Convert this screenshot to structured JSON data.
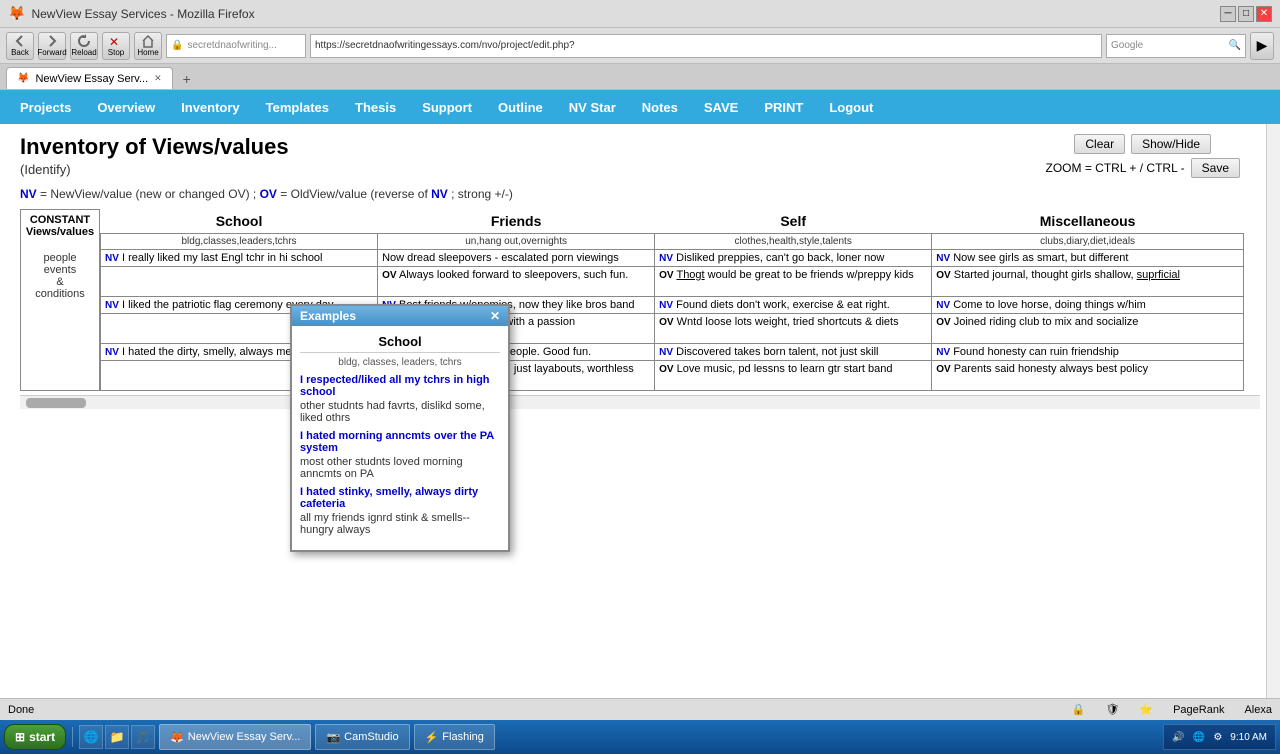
{
  "browser": {
    "title": "NewView Essay Services - Mozilla Firefox",
    "tab_label": "NewView Essay Serv...",
    "address": "https://secretdnaofwritingessays.com/nvo/project/edit.php?",
    "search_placeholder": "Google",
    "nav_buttons": [
      "Back",
      "Forward",
      "Reload",
      "Stop",
      "Home"
    ]
  },
  "nav_menu": {
    "items": [
      "Projects",
      "Overview",
      "Inventory",
      "Templates",
      "Thesis",
      "Support",
      "Outline",
      "NV Star",
      "Notes",
      "SAVE",
      "PRINT",
      "Logout"
    ]
  },
  "toolbar": {
    "clear_label": "Clear",
    "show_hide_label": "Show/Hide",
    "save_label": "Save",
    "zoom_text": "ZOOM = CTRL + / CTRL -"
  },
  "page": {
    "title": "Inventory of Views/values",
    "subtitle": "(Identify)",
    "legend": "NV = NewView/value (new or changed OV) ; OV = OldView/value (reverse of NV; strong +/-)"
  },
  "popup": {
    "title": "Examples",
    "column": "School",
    "subheader": "bldg, classes, leaders, tchrs",
    "items": [
      {
        "nv": "I respected/liked all my tchrs in high school",
        "ov": "other studnts had favrts, dislikd some, liked othrs"
      },
      {
        "nv": "I hated morning anncmts over the PA system",
        "ov": "most other studnts loved morning anncmts on PA"
      },
      {
        "nv": "I hated stinky, smelly, always dirty cafeteria",
        "ov": "all my friends ignrd stink & smells--hungry always"
      }
    ]
  },
  "table": {
    "constant_label": "CONSTANT\nViews/values",
    "constant_sub": "people\nevents\n&\nconditions",
    "columns": [
      {
        "header": "School",
        "subheader": "bldg,classes,leaders,tchrs",
        "rows": [
          {
            "nv": "I really liked my last Engl tchr in hi school",
            "ov": ""
          },
          {
            "nv": "I liked the patriotic flag ceremony every day",
            "ov": ""
          },
          {
            "nv": "I hated the dirty, smelly, always messy bathrooms",
            "ov": ""
          }
        ]
      },
      {
        "header": "Friends",
        "subheader": "un,hang out,overnights",
        "rows": [
          {
            "nv": "Now dread sleepovers - escalated porn viewings",
            "ov": "Always looked forward to sleepovers, such fun."
          },
          {
            "nv": "Best friends w/enemies, now they like bros band",
            "ov": "Hated Jen and Laura with a passion"
          },
          {
            "nv": "Got civic spirit, now help people. Good fun.",
            "ov": "Felt our group of frnds, just layabouts, worthless"
          }
        ]
      },
      {
        "header": "Self",
        "subheader": "clothes,health,style,talents",
        "rows": [
          {
            "nv": "Disliked preppies, can't go back, loner now",
            "ov": "Thogt would be great to be friends w/preppy kids"
          },
          {
            "nv": "Found diets don't work, exercise & eat right.",
            "ov": "Wntd loose lots weight, tried shortcuts & diets"
          },
          {
            "nv": "Discovered takes born talent, not just skill",
            "ov": "Love music, pd lessns to learn gtr start band"
          }
        ]
      },
      {
        "header": "Miscellaneous",
        "subheader": "clubs,diary,diet,ideals",
        "rows": [
          {
            "nv": "Now see girls as smart, but different",
            "ov": "Started journal, thought girls shallow, suprficial"
          },
          {
            "nv": "Come to love horse, doing things w/him",
            "ov": "Joined riding club to mix and socialize"
          },
          {
            "nv": "Found honesty can ruin friendship",
            "ov": "Parents said honesty always best policy"
          }
        ]
      }
    ]
  },
  "status_bar": {
    "status": "Done",
    "pagerank": "PageRank",
    "alexa": "Alexa"
  },
  "taskbar": {
    "start": "start",
    "items": [
      "NewView Essay Serv...",
      "CamStudio",
      "Flashing"
    ],
    "time": "9:10 AM"
  }
}
